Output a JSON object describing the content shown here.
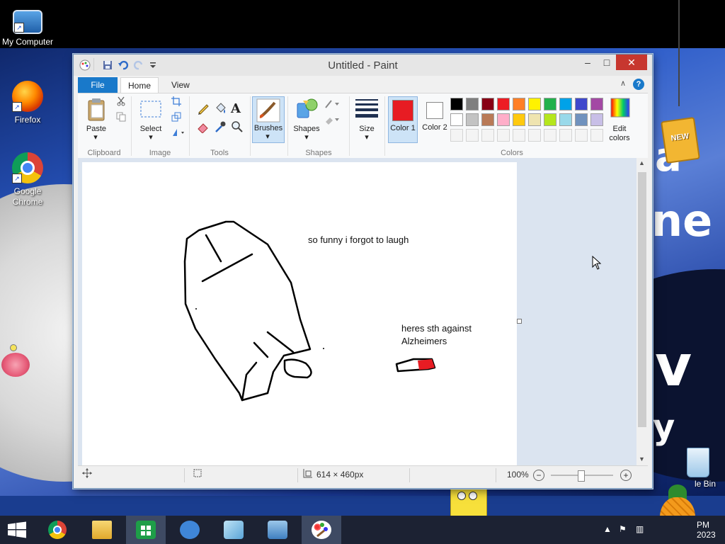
{
  "desktop": {
    "icons": [
      {
        "label": "My Computer"
      },
      {
        "label": "Firefox"
      },
      {
        "label": "Google Chrome"
      },
      {
        "label": "le Bin"
      }
    ],
    "wallpaper_text": [
      "a",
      "ne",
      "v",
      "y"
    ],
    "badge_text": "NEW"
  },
  "window": {
    "title": "Untitled - Paint",
    "controls": {
      "minimize": "–",
      "maximize": "□",
      "close": "✕"
    }
  },
  "ribbon": {
    "tabs": [
      {
        "label": "File",
        "active": false
      },
      {
        "label": "Home",
        "active": true
      },
      {
        "label": "View",
        "active": false
      }
    ],
    "groups": {
      "clipboard": {
        "label": "Clipboard",
        "paste": "Paste"
      },
      "image": {
        "label": "Image",
        "select": "Select"
      },
      "tools": {
        "label": "Tools"
      },
      "brushes": {
        "label": "Brushes"
      },
      "shapes": {
        "label": "Shapes",
        "shapes_button": "Shapes"
      },
      "size": {
        "label": "Size"
      },
      "colors": {
        "label": "Colors",
        "color1": "Color 1",
        "color1_value": "#e71c23",
        "color2": "Color 2",
        "color2_value": "#ffffff",
        "edit_colors": "Edit colors",
        "palette_row1": [
          "#000000",
          "#7f7f7f",
          "#880015",
          "#ed1c24",
          "#ff7f27",
          "#fff200",
          "#22b14c",
          "#00a2e8",
          "#3f48cc",
          "#a349a4"
        ],
        "palette_row2": [
          "#ffffff",
          "#c3c3c3",
          "#b97a57",
          "#ffaec9",
          "#ffc90e",
          "#efe4b0",
          "#b5e61d",
          "#99d9ea",
          "#7092be",
          "#c8bfe7"
        ]
      }
    }
  },
  "canvas": {
    "texts": [
      "so funny i forgot to laugh",
      "heres sth against",
      "Alzheimers"
    ]
  },
  "statusbar": {
    "dimensions": "614 × 460px",
    "zoom": "100%",
    "zoom_out": "−",
    "zoom_in": "+"
  },
  "taskbar": {
    "clock_time": "PM",
    "clock_date": "2023"
  }
}
